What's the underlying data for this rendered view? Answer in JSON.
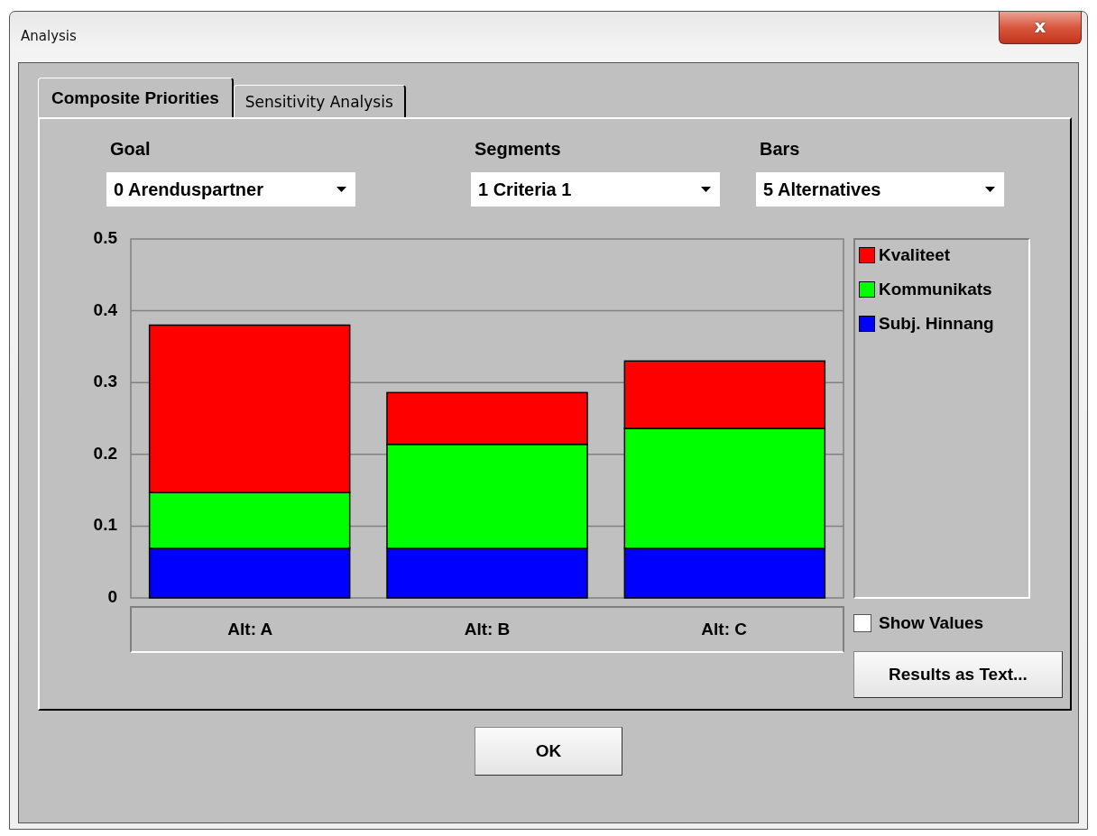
{
  "window": {
    "title": "Analysis",
    "close": "x"
  },
  "tabs": [
    {
      "label": "Composite Priorities",
      "selected": true
    },
    {
      "label": "Sensitivity Analysis",
      "selected": false
    }
  ],
  "selectors": [
    {
      "label": "Goal",
      "value": "0 Arenduspartner"
    },
    {
      "label": "Segments",
      "value": "1 Criteria 1"
    },
    {
      "label": "Bars",
      "value": "5 Alternatives"
    }
  ],
  "chart_data": {
    "type": "bar",
    "stacked": true,
    "grid": true,
    "categories": [
      "Alt: A",
      "Alt: B",
      "Alt: C"
    ],
    "ylim": [
      0,
      0.5
    ],
    "yticks": [
      {
        "value": 0,
        "label": "0"
      },
      {
        "value": 0.1,
        "label": "0.1"
      },
      {
        "value": 0.2,
        "label": "0.2"
      },
      {
        "value": 0.3,
        "label": "0.3"
      },
      {
        "value": 0.4,
        "label": "0.4"
      },
      {
        "value": 0.5,
        "label": "0.5"
      }
    ],
    "series": [
      {
        "name": "Subj. Hinnang",
        "color": "#0000ff",
        "values": [
          0.069,
          0.069,
          0.069
        ]
      },
      {
        "name": "Kommunikats",
        "color": "#00ff00",
        "values": [
          0.078,
          0.145,
          0.167
        ]
      },
      {
        "name": "Kvaliteet",
        "color": "#ff0000",
        "values": [
          0.233,
          0.072,
          0.094
        ]
      }
    ]
  },
  "show_values": {
    "label": "Show Values",
    "checked": false
  },
  "buttons": [
    {
      "label": "Results as Text..."
    },
    {
      "label": "OK"
    }
  ]
}
